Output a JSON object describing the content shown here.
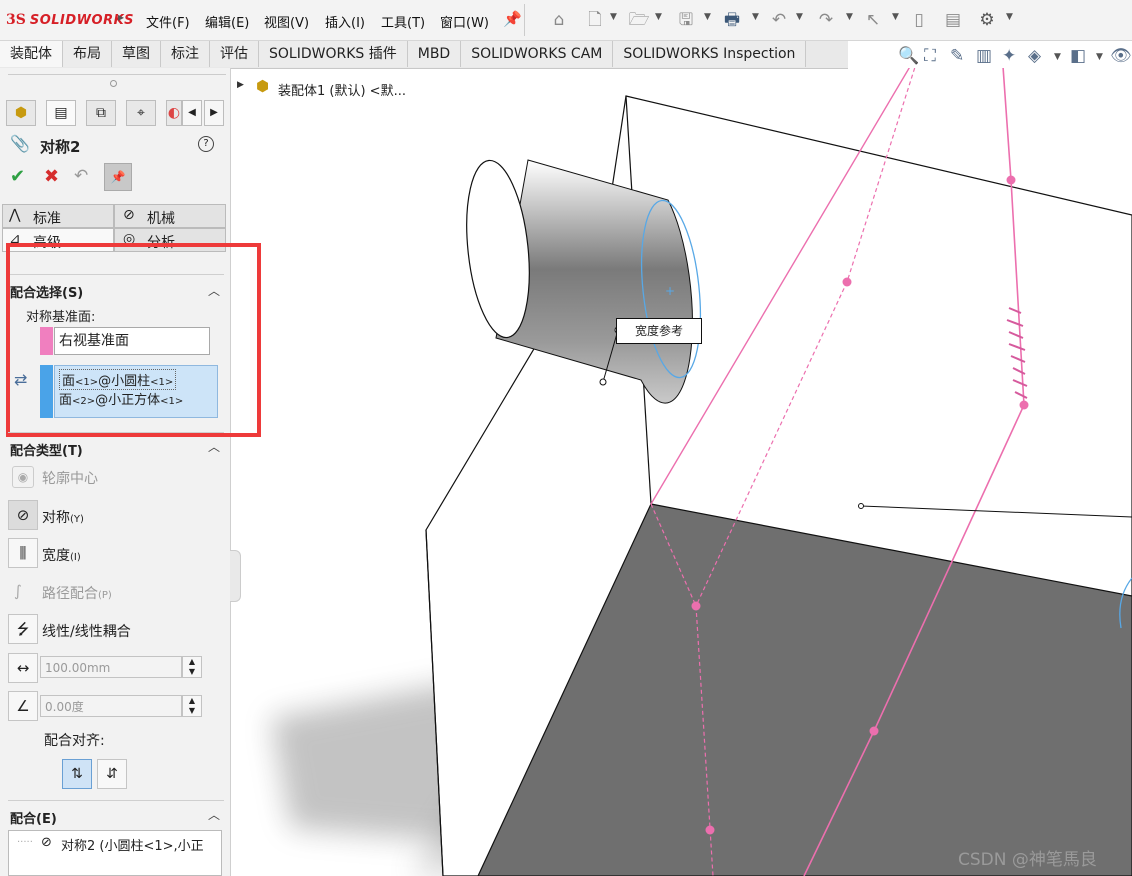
{
  "app": {
    "logo_ds": "3S",
    "logo_name": "SOLIDWORKS"
  },
  "menus": [
    "文件(F)",
    "编辑(E)",
    "视图(V)",
    "插入(I)",
    "工具(T)",
    "窗口(W)"
  ],
  "tabs": [
    "装配体",
    "布局",
    "草图",
    "标注",
    "评估",
    "SOLIDWORKS 插件",
    "MBD",
    "SOLIDWORKS CAM",
    "SOLIDWORKS Inspection"
  ],
  "tree": {
    "root_label": "装配体1 (默认) <默..."
  },
  "property": {
    "title": "对称2",
    "help": "?",
    "mode_tabs": [
      "标准",
      "机械",
      "高级",
      "分析"
    ],
    "mate_selection": {
      "header": "配合选择(S)",
      "plane_label": "对称基准面:",
      "plane_value": "右视基准面",
      "entities": [
        {
          "prefix": "面",
          "sub1": "<1>",
          "middle": "@小圆柱",
          "sub2": "<1>"
        },
        {
          "prefix": "面",
          "sub1": "<2>",
          "middle": "@小正方体",
          "sub2": "<1>"
        }
      ]
    },
    "mate_type": {
      "header": "配合类型(T)",
      "items": [
        {
          "label": "轮廓中心",
          "suffix": ""
        },
        {
          "label": "对称",
          "suffix": "(Y)"
        },
        {
          "label": "宽度",
          "suffix": "(I)"
        },
        {
          "label": "路径配合",
          "suffix": "(P)"
        },
        {
          "label": "线性/线性耦合",
          "suffix": ""
        }
      ],
      "distance": "100.00mm",
      "angle": "0.00度",
      "align_label": "配合对齐:"
    },
    "mates": {
      "header": "配合(E)",
      "item": "对称2 (小圆柱<1>,小正"
    }
  },
  "canvas": {
    "callout": "宽度参考"
  },
  "watermark": "CSDN @神笔馬良",
  "colors": {
    "accent_pink": "#ec6fae",
    "selection_blue": "#cde4f8",
    "red_frame": "#ee3a3a"
  }
}
